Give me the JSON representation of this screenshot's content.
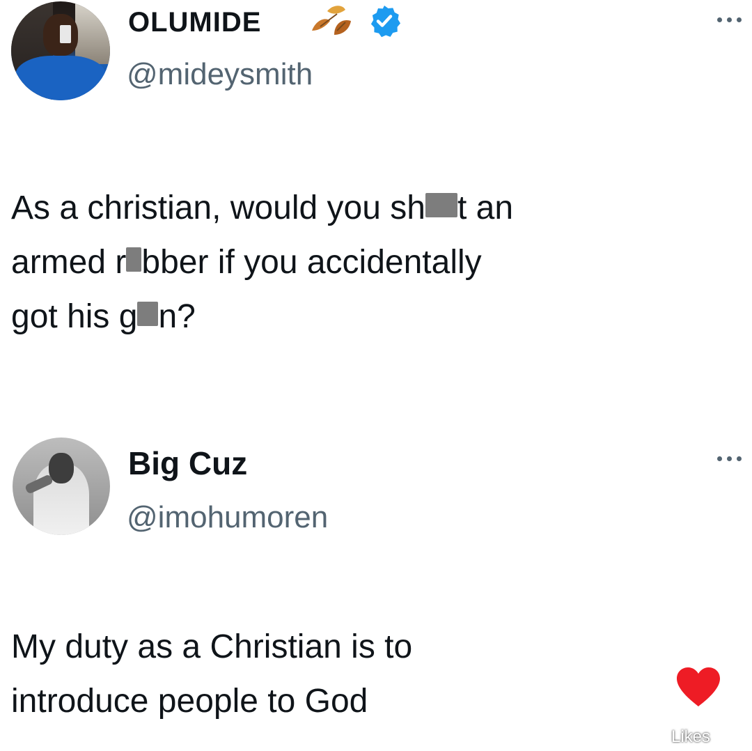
{
  "posts": [
    {
      "display_name": "OLUMIDE",
      "handle": "@mideysmith",
      "name_emoji": "leaf-icon",
      "verified": true,
      "text_parts": [
        "As a christian, would you sh",
        "t an\narmed r",
        "bber if you accidentally\ngot his g",
        "n?"
      ],
      "avatar": "avatar-photo"
    },
    {
      "display_name": "Big Cuz",
      "handle": "@imohumoren",
      "text": "My duty as a Christian is to\nintroduce people to God",
      "avatar": "avatar-photo"
    }
  ],
  "overlay": {
    "likes_label": "Likes",
    "heart_icon": "heart-icon",
    "heart_color": "#ee1c25"
  },
  "colors": {
    "verified_blue": "#1d9bf0",
    "handle_gray": "#536471",
    "text": "#0f1419"
  }
}
